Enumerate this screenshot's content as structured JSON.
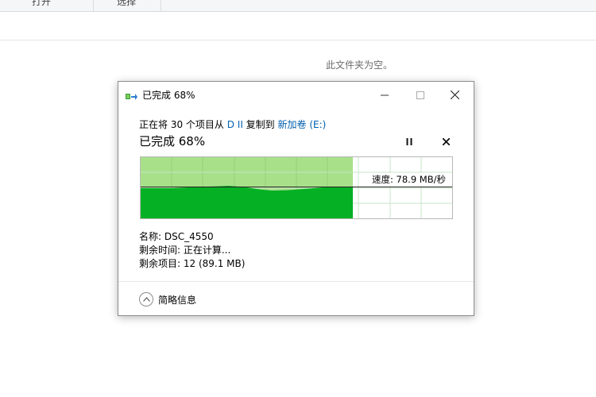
{
  "explorer": {
    "ribbon_groups": [
      "打开",
      "选择"
    ],
    "empty_message": "此文件夹为空。"
  },
  "dialog": {
    "title": "已完成 68%",
    "copy_line": {
      "prefix": "正在将 30 个项目从 ",
      "source": "D II",
      "middle": " 复制到 ",
      "destination": "新加卷 (E:)"
    },
    "progress_heading": "已完成 68%",
    "progress_fraction": 0.68,
    "speed": "速度: 78.9 MB/秒",
    "name_line": "名称: DSC_4550",
    "time_left_line": "剩余时间: 正在计算...",
    "items_left_line": "剩余项目: 12 (89.1 MB)",
    "details_label": "简略信息",
    "colors": {
      "progress_fill": "#a8e08a",
      "throughput_fill": "#06b025",
      "grid_line": "#c8e4c8",
      "link": "#0060b0"
    },
    "icons": {
      "title": "copy-files-icon",
      "minimize": "minimize-icon",
      "maximize": "maximize-icon",
      "close": "close-icon",
      "pause": "pause-icon",
      "cancel": "cancel-icon",
      "details": "chevron-up-icon"
    }
  }
}
